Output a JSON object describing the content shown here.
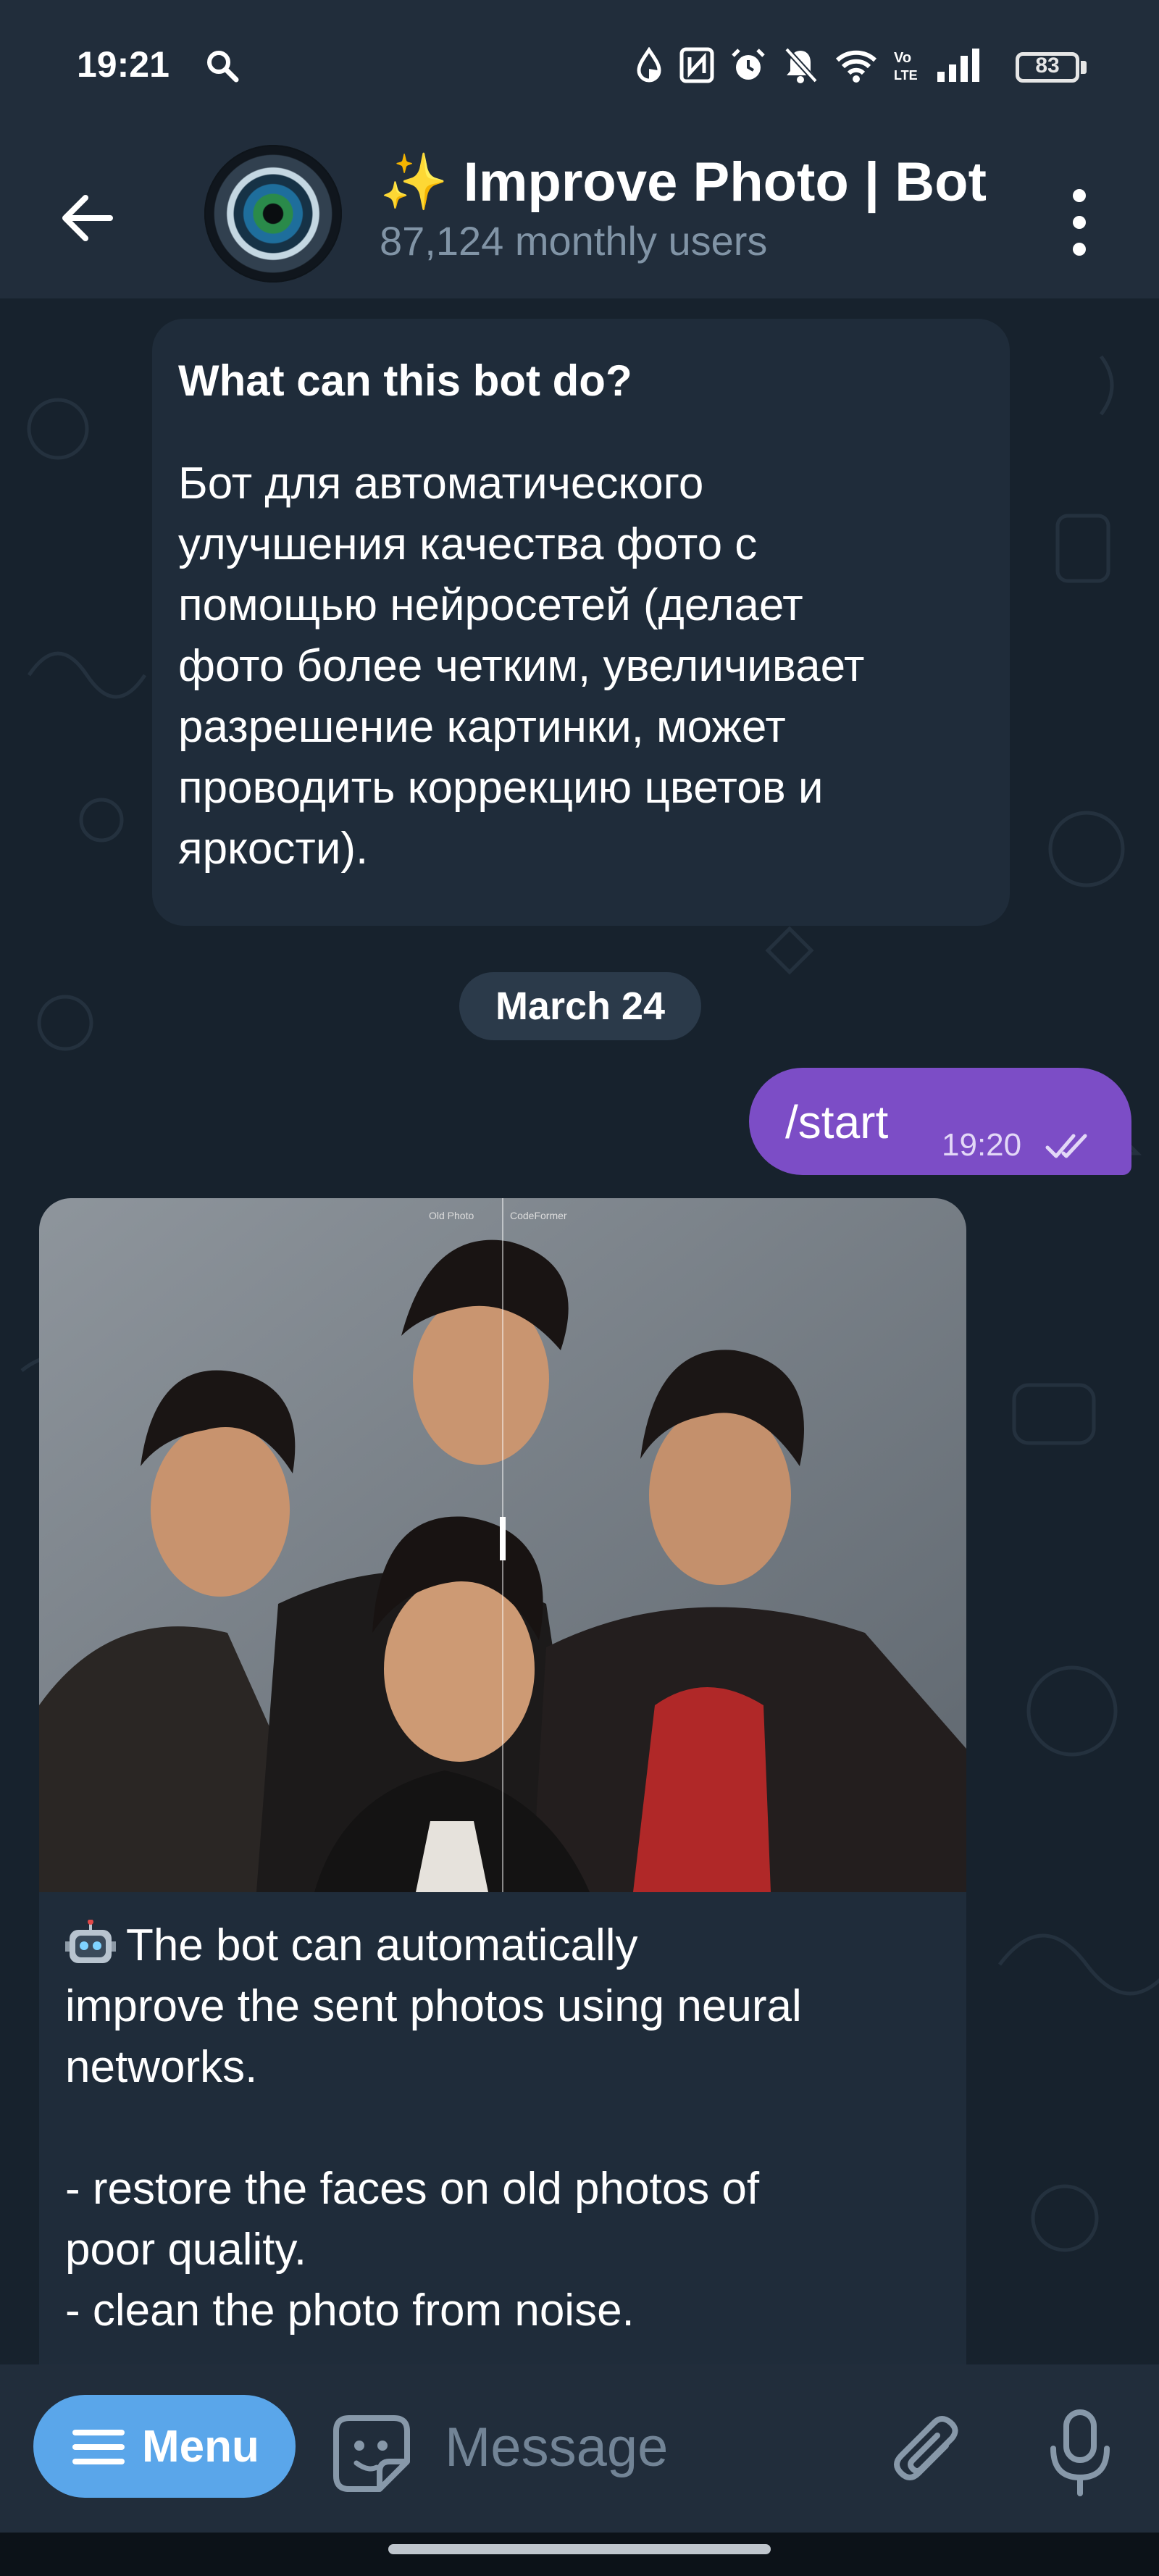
{
  "status_bar": {
    "time": "19:21",
    "battery": "83",
    "icons": [
      "search-icon",
      "data-saver-icon",
      "nfc-icon",
      "alarm-icon",
      "mute-icon",
      "wifi-icon",
      "volte-icon",
      "signal-icon",
      "battery-icon"
    ]
  },
  "header": {
    "title": "✨ Improve Photo | Bot",
    "subtitle": "87,124 monthly users",
    "icons": [
      "back-arrow-icon",
      "more-vert-icon"
    ]
  },
  "chat": {
    "intro": {
      "title": "What can this bot do?",
      "lines": [
        "Бот для автоматического",
        "улучшения качества фото с",
        "помощью нейросетей (делает",
        "фото более четким, увеличивает",
        "разрешение картинки, может",
        "проводить коррекцию цветов и",
        "яркости)."
      ]
    },
    "date_separator": "March 24",
    "outgoing": {
      "text": "/start",
      "time": "19:20",
      "status": "read"
    },
    "photo_message": {
      "image_labels": {
        "left": "Old Photo",
        "right": "CodeFormer"
      },
      "caption_lines": [
        "The bot can automatically",
        "improve the sent photos using neural",
        "networks.",
        "",
        "- restore the faces on old photos of",
        "poor quality.",
        "- clean the photo from noise."
      ],
      "caption_icon": "robot-face-icon"
    }
  },
  "input_bar": {
    "menu_label": "Menu",
    "placeholder": "Message",
    "icons": [
      "menu-lines-icon",
      "sticker-icon",
      "attach-icon",
      "microphone-icon"
    ]
  },
  "colors": {
    "header_bg": "#212d3b",
    "chat_bg": "#17222d",
    "bubble_in": "#1f2c3a",
    "bubble_out": "#7c4dc6",
    "menu_button": "#5aa6ea",
    "subtitle": "#8194a6"
  }
}
